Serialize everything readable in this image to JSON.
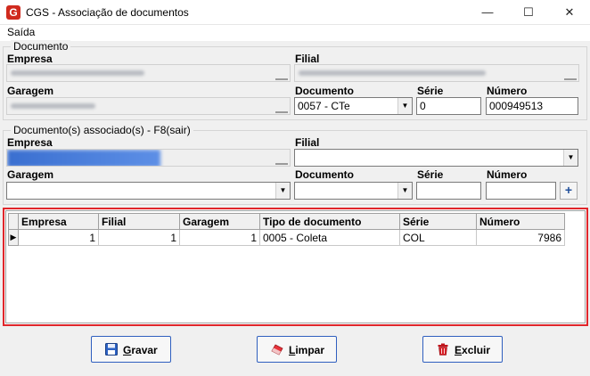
{
  "window": {
    "title": "CGS - Associação de documentos",
    "app_icon_letter": "G",
    "minimize": "—",
    "maximize": "☐",
    "close": "✕"
  },
  "menu": {
    "items": [
      "Saída"
    ]
  },
  "documento": {
    "legend": "Documento",
    "empresa_label": "Empresa",
    "filial_label": "Filial",
    "garagem_label": "Garagem",
    "documento_label": "Documento",
    "documento_value": "0057 - CTe",
    "serie_label": "Série",
    "serie_value": "0",
    "numero_label": "Número",
    "numero_value": "000949513"
  },
  "associados": {
    "legend": "Documento(s) associado(s) - F8(sair)",
    "empresa_label": "Empresa",
    "filial_label": "Filial",
    "garagem_label": "Garagem",
    "documento_label": "Documento",
    "serie_label": "Série",
    "numero_label": "Número",
    "add_button": "+"
  },
  "grid": {
    "columns": [
      "Empresa",
      "Filial",
      "Garagem",
      "Tipo de documento",
      "Série",
      "Número"
    ],
    "rows": [
      {
        "empresa": "1",
        "filial": "1",
        "garagem": "1",
        "tipo": "0005 - Coleta",
        "serie": "COL",
        "numero": "7986"
      }
    ]
  },
  "buttons": {
    "gravar": "Gravar",
    "limpar": "Limpar",
    "excluir": "Excluir"
  },
  "colors": {
    "highlight_border": "#e0262b",
    "button_border": "#2f5fbf"
  }
}
